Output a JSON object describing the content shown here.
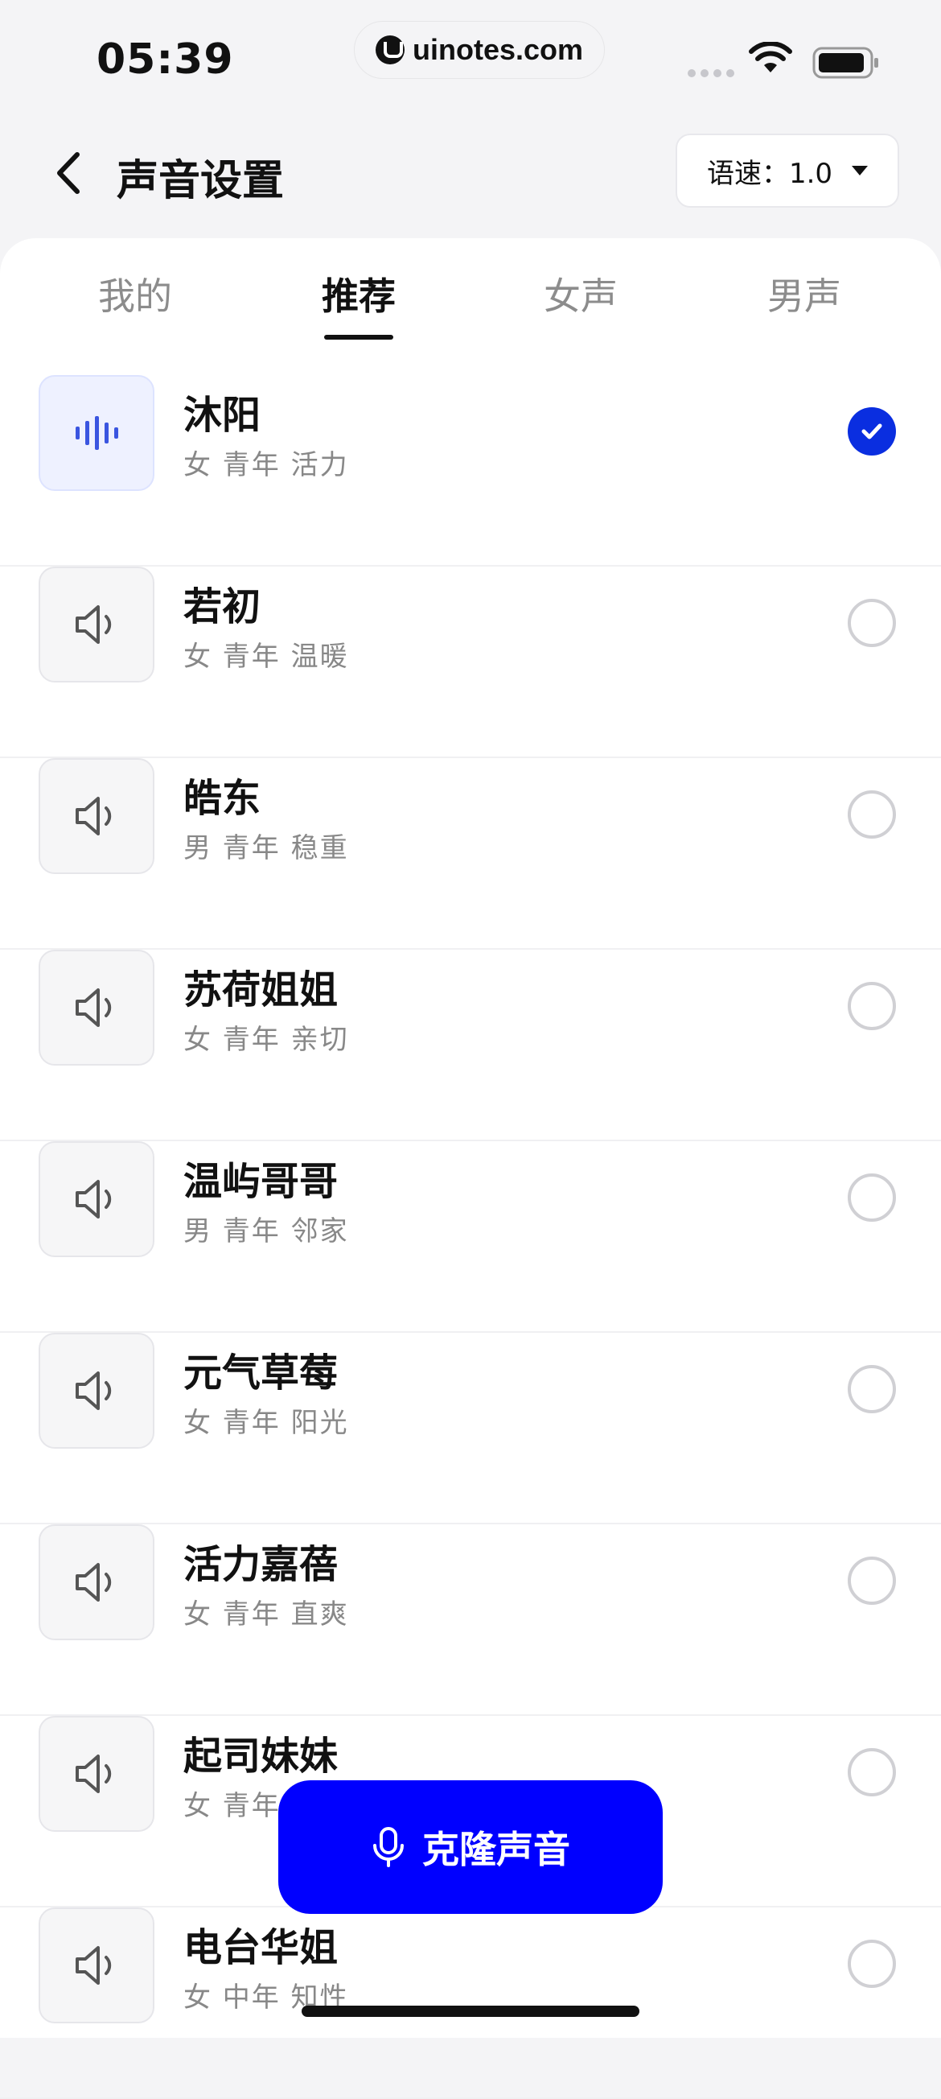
{
  "status_bar": {
    "time": "05:39",
    "brand": "uinotes.com",
    "icons": [
      "signal-dots-icon",
      "wifi-icon",
      "battery-icon"
    ]
  },
  "header": {
    "title": "声音设置",
    "back_icon": "chevron-left-icon",
    "speed_label": "语速：1.0"
  },
  "tabs": [
    {
      "label": "我的",
      "active": false
    },
    {
      "label": "推荐",
      "active": true
    },
    {
      "label": "女声",
      "active": false
    },
    {
      "label": "男声",
      "active": false
    }
  ],
  "voices": [
    {
      "name": "沐阳",
      "tags": "女 青年 活力",
      "selected": true
    },
    {
      "name": "若初",
      "tags": "女 青年 温暖",
      "selected": false
    },
    {
      "name": "皓东",
      "tags": "男 青年 稳重",
      "selected": false
    },
    {
      "name": "苏荷姐姐",
      "tags": "女 青年 亲切",
      "selected": false
    },
    {
      "name": "温屿哥哥",
      "tags": "男 青年 邻家",
      "selected": false
    },
    {
      "name": "元气草莓",
      "tags": "女 青年 阳光",
      "selected": false
    },
    {
      "name": "活力嘉蓓",
      "tags": "女 青年 直爽",
      "selected": false
    },
    {
      "name": "起司妹妹",
      "tags": "女 青年",
      "selected": false
    },
    {
      "name": "电台华姐",
      "tags": "女 中年 知性",
      "selected": false
    }
  ],
  "clone_button": {
    "label": "克隆声音",
    "icon": "microphone-icon"
  },
  "colors": {
    "accent": "#0000ff",
    "check": "#0a2ee0",
    "wave": "#3a55e0"
  }
}
